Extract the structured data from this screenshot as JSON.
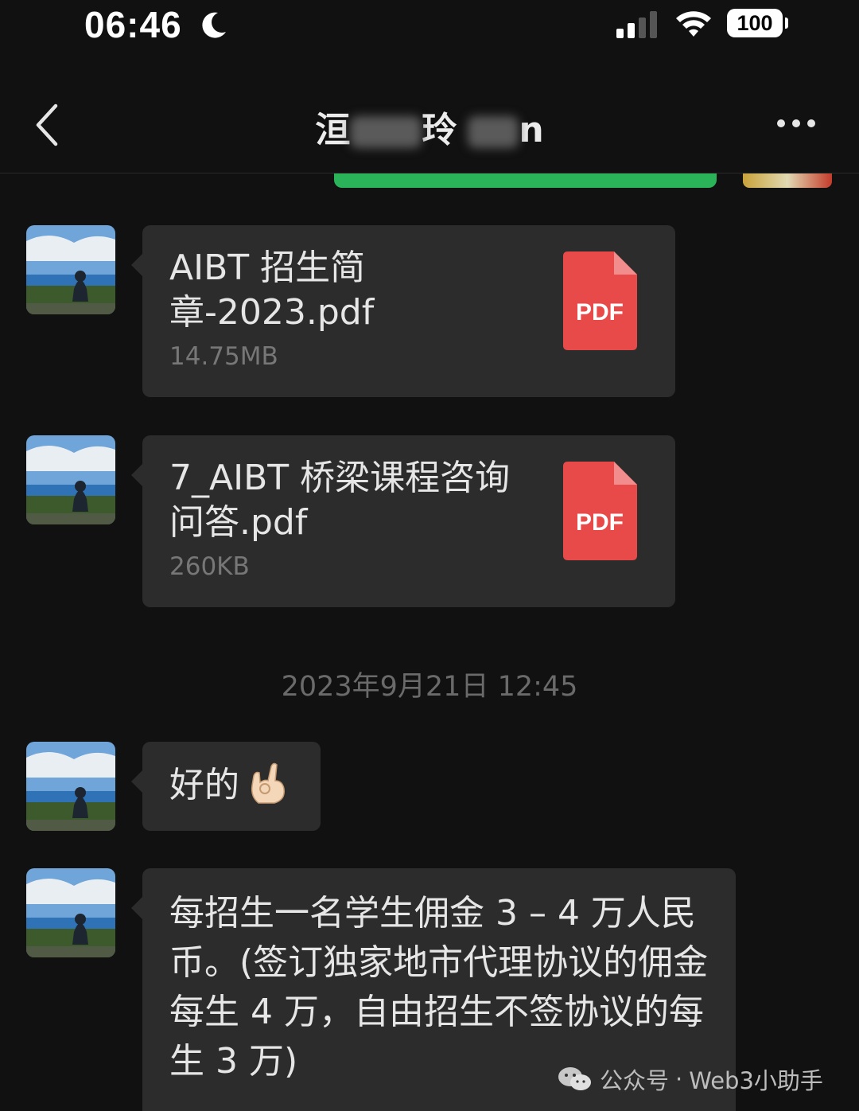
{
  "status_bar": {
    "time": "06:46",
    "battery": "100"
  },
  "nav": {
    "title_visible_1": "洹",
    "title_visible_2": "玲",
    "title_visible_3": "n"
  },
  "messages": [
    {
      "type": "file",
      "file_name": "AIBT 招生简章-2023.pdf",
      "file_size": "14.75MB",
      "file_label": "PDF"
    },
    {
      "type": "file",
      "file_name": "7_AIBT 桥梁课程咨询问答.pdf",
      "file_size": "260KB",
      "file_label": "PDF"
    },
    {
      "type": "timestamp",
      "text": "2023年9月21日 12:45"
    },
    {
      "type": "text",
      "text": "好的"
    },
    {
      "type": "text",
      "text": "每招生一名学生佣金 3 – 4 万人民币。(签订独家地市代理协议的佣金每生 4 万，自由招生不签协议的每生 3 万)"
    }
  ],
  "watermark": {
    "source": "公众号",
    "separator": "·",
    "account": "Web3小助手"
  },
  "icons": [
    "moon-icon",
    "signal-icon",
    "wifi-icon",
    "back-chevron-icon",
    "more-dots-icon",
    "pdf-file-icon",
    "ok-hand-emoji-icon",
    "wechat-logo-icon"
  ],
  "colors": {
    "background": "#111111",
    "bubble": "#2c2c2c",
    "pdf_red": "#e84a4a",
    "accent_green": "#2bb35a"
  }
}
